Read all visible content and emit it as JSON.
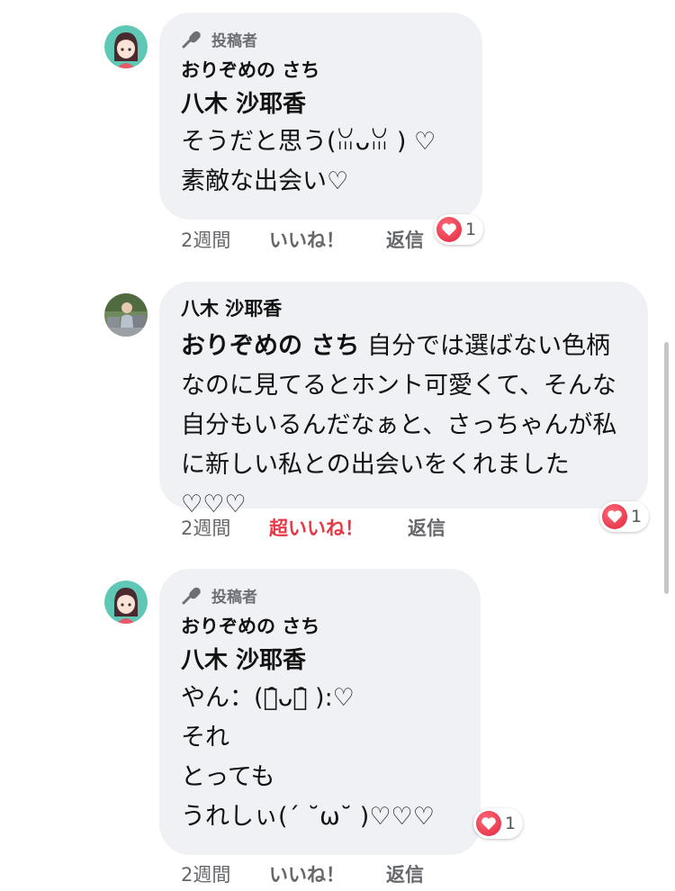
{
  "comments": [
    {
      "badge_label": "投稿者",
      "author": "おりぞめの さち",
      "mention": "八木 沙耶香",
      "lines": [
        "そうだと思う(ꈍᴗꈍ ) ♡",
        "素敵な出会い♡"
      ],
      "time": "2週間",
      "like_label": "いいね！",
      "reply_label": "返信",
      "reaction_count": "1"
    },
    {
      "author": "八木 沙耶香",
      "mention": "おりぞめの さち",
      "body": " 自分では選ばない色柄なのに見てるとホント可愛くて、そんな自分もいるんだなぁと、さっちゃんが私に新しい私との出会いをくれました♡♡♡",
      "time": "2週間",
      "like_label": "超いいね！",
      "reply_label": "返信",
      "reaction_count": "1"
    },
    {
      "badge_label": "投稿者",
      "author": "おりぞめの さち",
      "mention": "八木 沙耶香",
      "lines": [
        "やん：(ꈍ̑ᴗꈍ̑ ):♡",
        "それ",
        "とっても",
        "うれしぃ(´ ˘ω˘ )♡♡♡"
      ],
      "time": "2週間",
      "like_label": "いいね！",
      "reply_label": "返信",
      "reaction_count": "1"
    }
  ],
  "icons": {
    "badge": "microphone-icon",
    "reaction": "heart-icon"
  },
  "colors": {
    "bubble": "#f0f1f4",
    "super_like": "#e53947",
    "reaction": "#e0243c"
  }
}
